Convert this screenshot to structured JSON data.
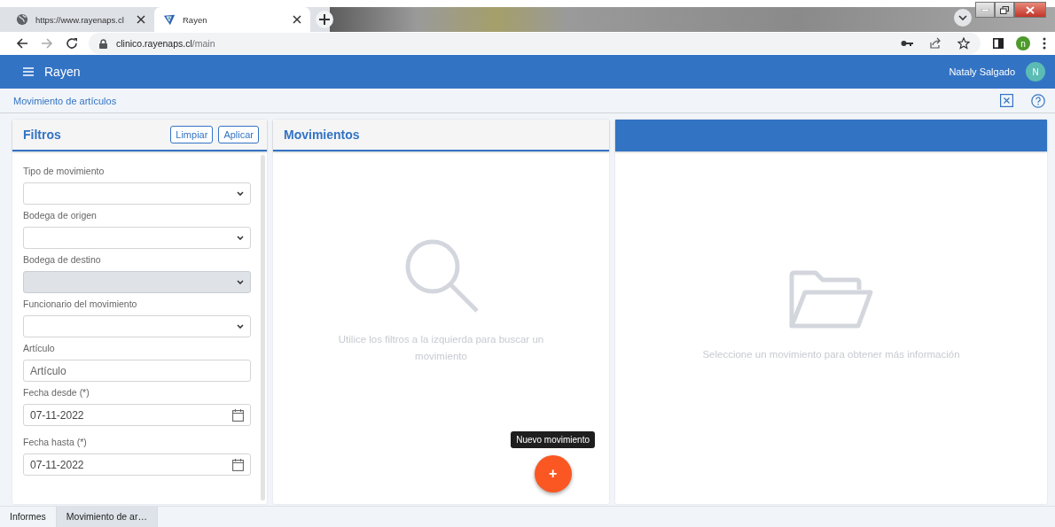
{
  "browser": {
    "tabs": [
      {
        "title": "https://www.rayenaps.cl",
        "selected": false,
        "kind": "globe"
      },
      {
        "title": "Rayen",
        "selected": true,
        "kind": "logo"
      }
    ],
    "address": {
      "host": "clinico.rayenaps.cl",
      "path": "/main"
    },
    "profile_initial": "n"
  },
  "app_bar": {
    "title": "Rayen",
    "user": "Nataly Salgado",
    "avatar_initial": "N"
  },
  "breadcrumb": "Movimiento de artículos",
  "filters": {
    "title": "Filtros",
    "buttons": [
      "Limpiar",
      "Aplicar"
    ],
    "fields": [
      {
        "label": "Tipo de movimiento",
        "kind": "select",
        "disabled": false
      },
      {
        "label": "Bodega de origen",
        "kind": "select",
        "disabled": false
      },
      {
        "label": "Bodega de destino",
        "kind": "select",
        "disabled": true
      },
      {
        "label": "Funcionario del movimiento",
        "kind": "select",
        "disabled": false
      },
      {
        "label": "Artículo",
        "kind": "text",
        "placeholder": "Artículo",
        "disabled": false
      },
      {
        "label": "Fecha desde (*)",
        "kind": "date",
        "value": "07-11-2022",
        "disabled": false
      },
      {
        "label": "Fecha hasta (*)",
        "kind": "date",
        "value": "07-11-2022",
        "disabled": false
      }
    ]
  },
  "movements": {
    "title": "Movimientos",
    "empty_message": "Utilice los filtros a la izquierda para buscar un movimiento",
    "fab": {
      "label": "+",
      "tooltip": "Nuevo movimiento"
    }
  },
  "detail": {
    "empty_message": "Seleccione un movimiento para obtener más información"
  },
  "bottom_tabs": [
    {
      "label": "Informes",
      "selected": false
    },
    {
      "label": "Movimiento de ar…",
      "selected": true
    }
  ]
}
